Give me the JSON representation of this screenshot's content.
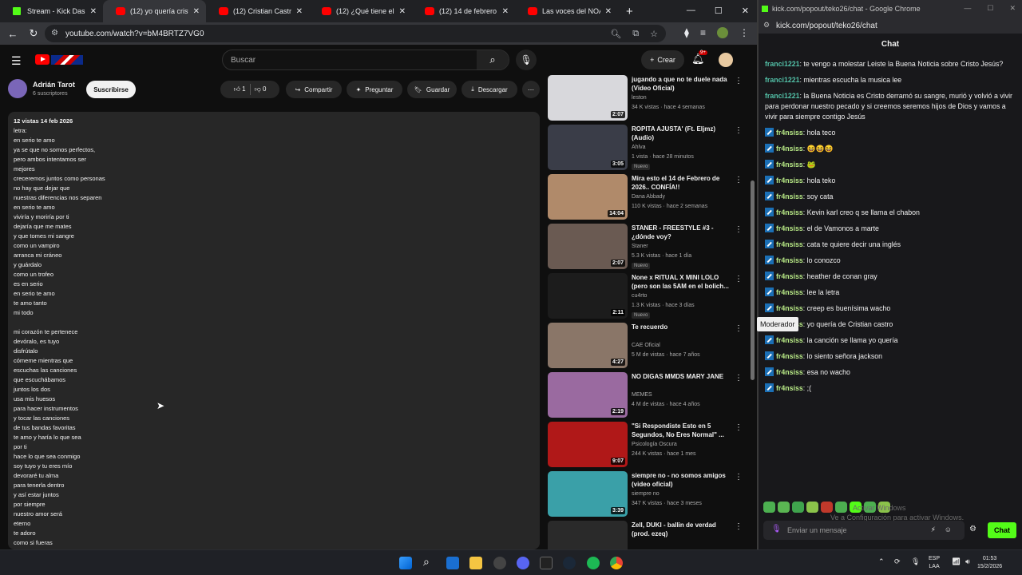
{
  "browser_tabs": [
    {
      "title": "Stream - Kick Dashboa",
      "kind": "kick",
      "active": false
    },
    {
      "title": "(12) yo quería cristian c",
      "kind": "yt",
      "active": true
    },
    {
      "title": "(12) Cristian Castro - Yo",
      "kind": "yt",
      "active": false
    },
    {
      "title": "(12) ¿Qué tiene ella qu",
      "kind": "yt",
      "active": false
    },
    {
      "title": "(12) 14 de febrero - Yo",
      "kind": "yt",
      "active": false
    },
    {
      "title": "Las voces del NOA - Lo",
      "kind": "yt",
      "active": false
    }
  ],
  "url": "youtube.com/watch?v=bM4BRTZ7VG0",
  "yt": {
    "search_placeholder": "Buscar",
    "create_label": "Crear",
    "notif_badge": "9+"
  },
  "channel": {
    "name": "Adrián Tarot",
    "subs": "6 suscriptores",
    "subscribe": "Suscribirse",
    "likes": "1",
    "dislikes": "0",
    "share": "Compartir",
    "ask": "Preguntar",
    "save": "Guardar",
    "download": "Descargar"
  },
  "description": {
    "meta": "12 vistas  14 feb 2026",
    "lines": [
      "letra:",
      "en serio te amo",
      "ya se que no somos perfectos,",
      "pero ambos intentamos ser",
      "mejores",
      "creceremos juntos como personas",
      "no hay que dejar que",
      "nuestras diferencias nos separen",
      "en serio te amo",
      "viviría y moriría por ti",
      "dejaría que me mates",
      "y que tomes mi sangre",
      "como un vampiro",
      "arranca mi cráneo",
      "y guárdalo",
      "como un trofeo",
      "es en serio",
      "en serio te amo",
      "te amo tanto",
      "mi todo",
      "",
      "mi corazón te pertenece",
      "devóralo, es tuyo",
      "disfrútalo",
      "cómeme mientras que",
      "escuchas las canciones",
      "que escuchábamos",
      "juntos los dos",
      "usa mis huesos",
      "para hacer instrumentos",
      "y tocar las canciones",
      "de tus bandas favoritas",
      "te amo y haría lo que sea",
      "por ti",
      "hace lo que sea conmigo",
      "soy tuyo y tu eres mío",
      "devoraré tu alma",
      "para tenerla dentro",
      "y así estar juntos",
      "por siempre",
      "nuestro amor será",
      "eterno",
      "te adoro",
      "como si fueras"
    ]
  },
  "sidebar": [
    {
      "title": "jugando a que no te duele nada (Video Oficial)",
      "channel": "leston",
      "meta": "34 K vistas · hace 4 semanas",
      "duration": "2:07",
      "new": "",
      "thumb": "#d8d8dc"
    },
    {
      "title": "ROPITA AJUSTA' (Ft. Eljmz) (Audio)",
      "channel": "Ahlva",
      "meta": "1 vista · hace 28 minutos",
      "duration": "3:05",
      "new": "Nuevo",
      "thumb": "#3a3d48"
    },
    {
      "title": "Mira esto el 14 de Febrero de 2026.. CONFÍA!!",
      "channel": "Dana Abbady",
      "meta": "110 K vistas · hace 2 semanas",
      "duration": "14:04",
      "new": "",
      "thumb": "#b08a6a"
    },
    {
      "title": "STANER - FREESTYLE #3 - ¿dónde voy?",
      "channel": "Staner",
      "meta": "5.3 K vistas · hace 1 día",
      "duration": "2:07",
      "new": "Nuevo",
      "thumb": "#6a5a52"
    },
    {
      "title": "None x RITUAL X MINI LOLO (pero son las 5AM en el bolich...",
      "channel": "cu4rto",
      "meta": "1.3 K vistas · hace 3 días",
      "duration": "2:11",
      "new": "Nuevo",
      "thumb": "#1c1c1c"
    },
    {
      "title": "Te recuerdo",
      "channel": "CAE Oficial",
      "meta": "5 M de vistas · hace 7 años",
      "duration": "4:27",
      "new": "",
      "thumb": "#8a7668"
    },
    {
      "title": "NO DIGAS MMDS MARY JANE",
      "channel": "MEMES",
      "meta": "4 M de vistas · hace 4 años",
      "duration": "2:19",
      "new": "",
      "thumb": "#9a6aa0"
    },
    {
      "title": "\"Si Respondiste Esto en 5 Segundos, No Eres Normal\" ...",
      "channel": "Psicología Oscura",
      "meta": "244 K vistas · hace 1 mes",
      "duration": "9:07",
      "new": "",
      "thumb": "#b01818"
    },
    {
      "title": "siempre no - no somos amigos (video oficial)",
      "channel": "siempre no",
      "meta": "347 K vistas · hace 3 meses",
      "duration": "3:39",
      "new": "",
      "thumb": "#3aa0a8"
    },
    {
      "title": "Zell, DUKI - ballin de verdad (prod. ezeq)",
      "channel": "",
      "meta": "",
      "duration": "",
      "new": "",
      "thumb": "#2a2a2a"
    }
  ],
  "kick": {
    "window_title": "kick.com/popout/teko26/chat - Google Chrome",
    "url": "kick.com/popout/teko26/chat",
    "header": "Chat",
    "tooltip": "Moderador",
    "input_placeholder": "Enviar un mensaje",
    "send": "Chat",
    "watermark_1": "Activar Windows",
    "watermark_2": "Ve a Configuración para activar Windows.",
    "messages": [
      {
        "user": "franci1221",
        "text": "te vengo a molestar Leiste la Buena Noticia sobre Cristo Jesús?",
        "mod": false
      },
      {
        "user": "franci1221",
        "text": "mientras escucha la musica lee",
        "mod": false
      },
      {
        "user": "franci1221",
        "text": "la Buena Noticia es Cristo derramó su sangre, murió y volvió a vivir para perdonar nuestro pecado y si creemos seremos hijos de Dios y vamos a vivir para siempre contigo Jesús",
        "mod": false
      },
      {
        "user": "fr4nsiss",
        "text": "hola teco",
        "mod": true
      },
      {
        "user": "fr4nsiss",
        "text": "😆😆😆",
        "mod": true
      },
      {
        "user": "fr4nsiss",
        "text": "🐸",
        "mod": true
      },
      {
        "user": "fr4nsiss",
        "text": "hola teko",
        "mod": true
      },
      {
        "user": "fr4nsiss",
        "text": "soy cata",
        "mod": true
      },
      {
        "user": "fr4nsiss",
        "text": "Kevin karl creo q se llama el chabon",
        "mod": true
      },
      {
        "user": "fr4nsiss",
        "text": "el de Vamonos a marte",
        "mod": true
      },
      {
        "user": "fr4nsiss",
        "text": "cata te quiere decir una inglés",
        "mod": true
      },
      {
        "user": "fr4nsiss",
        "text": "lo conozco",
        "mod": true
      },
      {
        "user": "fr4nsiss",
        "text": "heather de conan gray",
        "mod": true
      },
      {
        "user": "fr4nsiss",
        "text": "lee la letra",
        "mod": true
      },
      {
        "user": "fr4nsiss",
        "text": "creep es buenísima wacho",
        "mod": true
      },
      {
        "user": "fr4nsiss",
        "text": "yo quería de Cristian castro",
        "mod": true
      },
      {
        "user": "fr4nsiss",
        "text": "la canción se llama yo quería",
        "mod": true
      },
      {
        "user": "fr4nsiss",
        "text": "lo siento señora jackson",
        "mod": true
      },
      {
        "user": "fr4nsiss",
        "text": "esa no wacho",
        "mod": true
      },
      {
        "user": "fr4nsiss",
        "text": ";(",
        "mod": true
      }
    ]
  },
  "taskbar": {
    "lang": "ESP",
    "layout": "LAA",
    "time": "01:53",
    "date": "15/2/2026"
  }
}
